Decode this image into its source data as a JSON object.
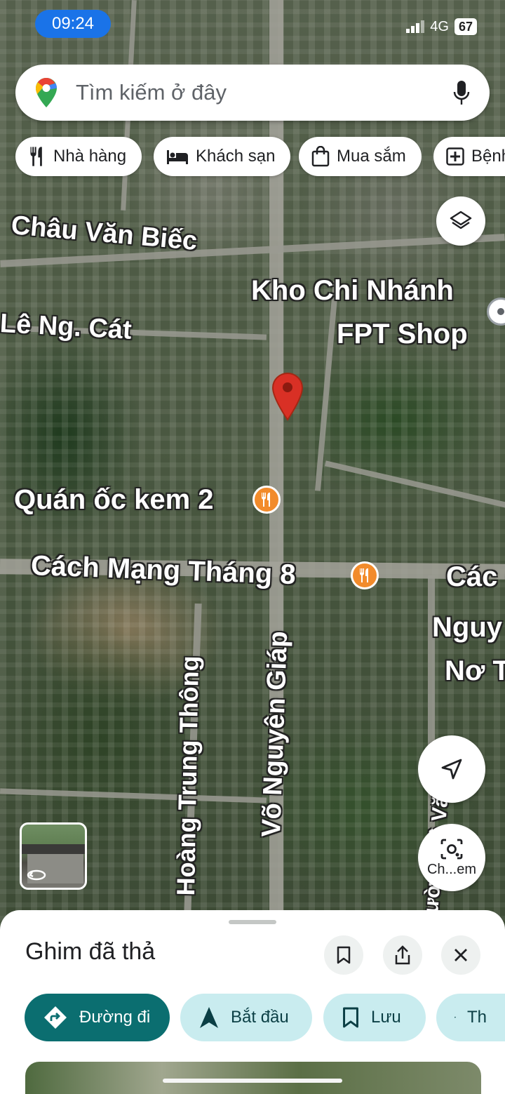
{
  "status_bar": {
    "time": "09:24",
    "network": "4G",
    "battery": "67"
  },
  "search": {
    "placeholder": "Tìm kiếm ở đây"
  },
  "chips": [
    {
      "label": "Nhà hàng",
      "icon": "utensils-icon"
    },
    {
      "label": "Khách sạn",
      "icon": "bed-icon"
    },
    {
      "label": "Mua sắm",
      "icon": "shopping-bag-icon"
    },
    {
      "label": "Bệnh",
      "icon": "hospital-icon"
    }
  ],
  "map_labels": {
    "chau_van_biec": "Châu Văn Biếc",
    "le_ng_cat": "Lê Ng. Cát",
    "kho_line1": "Kho Chi Nhánh",
    "kho_line2": "FPT Shop",
    "quan_oc_kem": "Quán ốc kem 2",
    "cach_mang": "Cách Mạng Tháng 8",
    "cach_right": "Các",
    "nguy": "Nguy",
    "no_t": "Nơ T",
    "vo_nguyen_giap": "Võ Nguyên Giáp",
    "hoang_trung_thong": "Hoàng Trung Thông",
    "edge_label": "ường Lê Văn"
  },
  "controls": {
    "lens_label": "Ch...em"
  },
  "sheet": {
    "title": "Ghim đã thả",
    "actions": [
      {
        "label": "Đường đi",
        "icon": "directions-icon"
      },
      {
        "label": "Bắt đầu",
        "icon": "navigation-arrow-icon"
      },
      {
        "label": "Lưu",
        "icon": "bookmark-icon"
      },
      {
        "label": "Th",
        "icon": "flag-icon"
      }
    ]
  },
  "colors": {
    "accent": "#0b6e70",
    "pin": "#d93025",
    "poi": "#f28b2b",
    "time_pill": "#1a73e8"
  }
}
